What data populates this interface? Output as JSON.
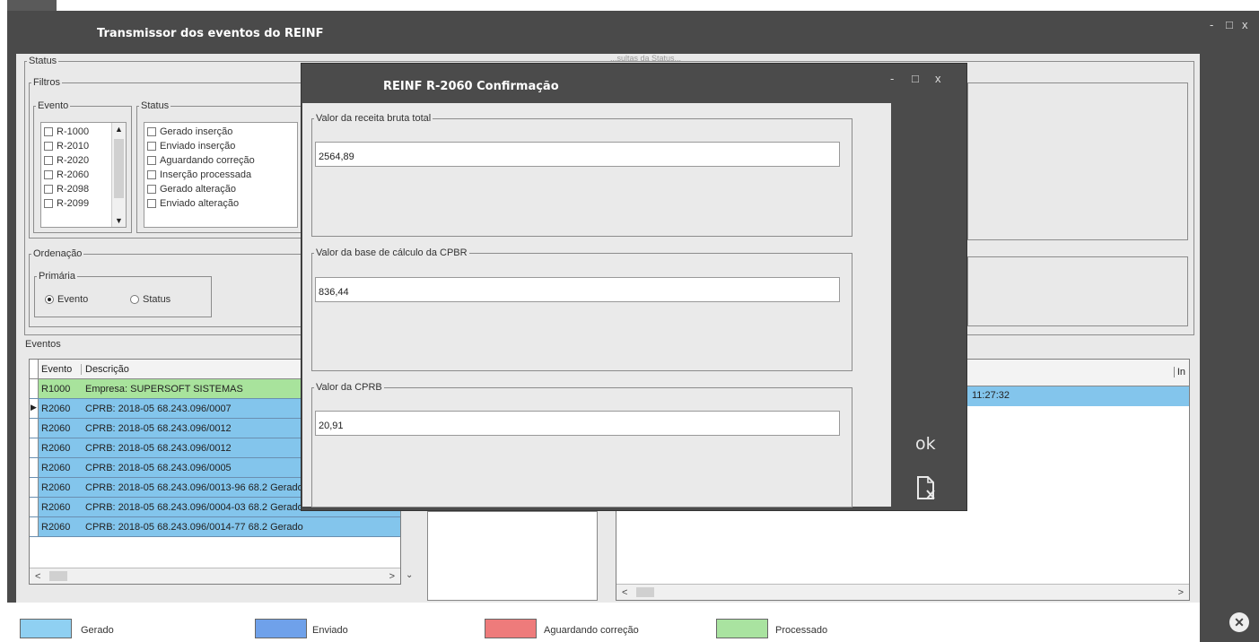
{
  "window": {
    "title": "Transmissor dos eventos do REINF",
    "controls": [
      "-",
      "□",
      "x"
    ]
  },
  "status_group": {
    "legend": "Status",
    "obscured_legend": "...sultas da Status..."
  },
  "filtros": {
    "legend": "Filtros",
    "evento": {
      "legend": "Evento",
      "items": [
        "R-1000",
        "R-2010",
        "R-2020",
        "R-2060",
        "R-2098",
        "R-2099"
      ]
    },
    "status": {
      "legend": "Status",
      "items": [
        "Gerado inserção",
        "Enviado inserção",
        "Aguardando correção",
        "Inserção processada",
        "Gerado alteração",
        "Enviado alteração"
      ]
    }
  },
  "ordenacao": {
    "legend": "Ordenação",
    "primaria": {
      "legend": "Primária",
      "options": [
        {
          "label": "Evento",
          "selected": true
        },
        {
          "label": "Status",
          "selected": false
        }
      ]
    }
  },
  "eventos": {
    "label": "Eventos",
    "columns": [
      "Evento",
      "Descrição"
    ],
    "rows": [
      {
        "evento": "R1000",
        "descricao": "Empresa: SUPERSOFT SISTEMAS",
        "color": "#a8e39c"
      },
      {
        "evento": "R2060",
        "descricao": "CPRB: 2018-05 68.243.096/0007",
        "color": "#83c5ec"
      },
      {
        "evento": "R2060",
        "descricao": "CPRB: 2018-05 68.243.096/0012",
        "color": "#83c5ec"
      },
      {
        "evento": "R2060",
        "descricao": "CPRB: 2018-05 68.243.096/0012",
        "color": "#83c5ec"
      },
      {
        "evento": "R2060",
        "descricao": "CPRB: 2018-05 68.243.096/0005",
        "color": "#83c5ec"
      },
      {
        "evento": "R2060",
        "descricao": "CPRB: 2018-05 68.243.096/0013-96 68.2 Gerado",
        "color": "#83c5ec"
      },
      {
        "evento": "R2060",
        "descricao": "CPRB: 2018-05 68.243.096/0004-03 68.2 Gerado",
        "color": "#83c5ec"
      },
      {
        "evento": "R2060",
        "descricao": "CPRB: 2018-05 68.243.096/0014-77 68.2 Gerado",
        "color": "#83c5ec"
      }
    ]
  },
  "right_grid": {
    "header_fragment": "In",
    "first_row_time": "11:27:32"
  },
  "legend_bar": [
    {
      "label": "Gerado",
      "color": "#8fd0f2"
    },
    {
      "label": "Enviado",
      "color": "#6fa1ea"
    },
    {
      "label": "Aguardando correção",
      "color": "#ee7b7b"
    },
    {
      "label": "Processado",
      "color": "#a9e3a0"
    }
  ],
  "dialog": {
    "title": "REINF R-2060 Confirmação",
    "controls": [
      "-",
      "□",
      "x"
    ],
    "fields": [
      {
        "label": "Valor da receita bruta total",
        "value": "2564,89"
      },
      {
        "label": "Valor da base de cálculo da CPBR",
        "value": "836,44"
      },
      {
        "label": "Valor da CPRB",
        "value": "20,91"
      }
    ],
    "ok_label": "ok",
    "cancel_icon": "cancel-document-icon"
  },
  "close_icon": "close-circle-icon"
}
